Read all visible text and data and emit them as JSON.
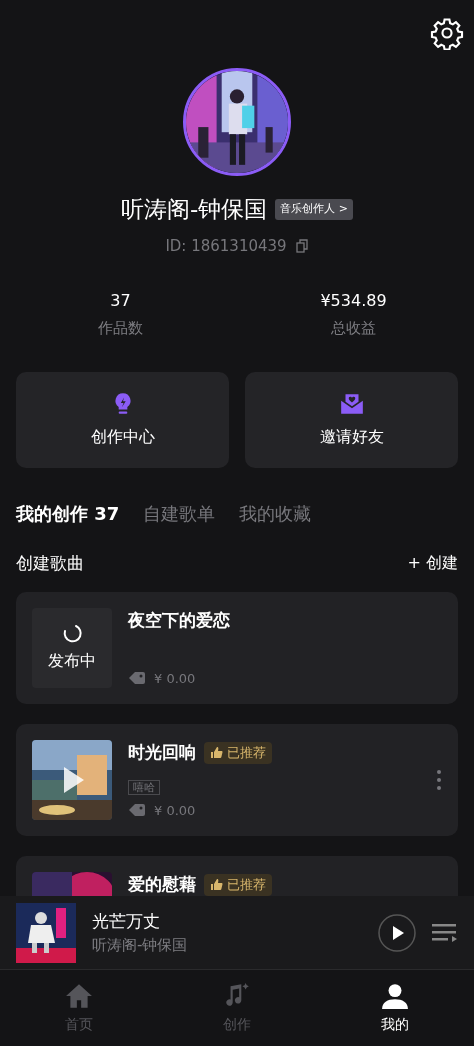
{
  "profile": {
    "name": "听涛阁-钟保国",
    "badge": "音乐创作人 >",
    "id": "ID: 1861310439"
  },
  "stats": [
    {
      "value": "37",
      "label": "作品数"
    },
    {
      "value": "¥534.89",
      "label": "总收益"
    }
  ],
  "actions": [
    {
      "label": "创作中心",
      "kind": "bulb"
    },
    {
      "label": "邀请好友",
      "kind": "mail"
    }
  ],
  "tabs": [
    {
      "label": "我的创作 37",
      "selected": true
    },
    {
      "label": "自建歌单",
      "selected": false
    },
    {
      "label": "我的收藏",
      "selected": false
    }
  ],
  "section": {
    "title": "创建歌曲",
    "action": "+ 创建"
  },
  "songs": [
    {
      "kind": "publishing",
      "title": "夜空下的爱恋",
      "status": "发布中",
      "price": "¥ 0.00"
    },
    {
      "kind": "published",
      "title": "时光回响",
      "badge": "已推荐",
      "genre": "嘻哈",
      "price": "¥ 0.00"
    },
    {
      "kind": "published",
      "title": "爱的慰藉",
      "badge": "已推荐"
    }
  ],
  "player": {
    "title": "光芒万丈",
    "artist": "听涛阁-钟保国"
  },
  "nav": [
    {
      "kind": "home",
      "label": "首页",
      "selected": false
    },
    {
      "kind": "music",
      "label": "创作",
      "selected": false
    },
    {
      "kind": "user",
      "label": "我的",
      "selected": true
    }
  ]
}
